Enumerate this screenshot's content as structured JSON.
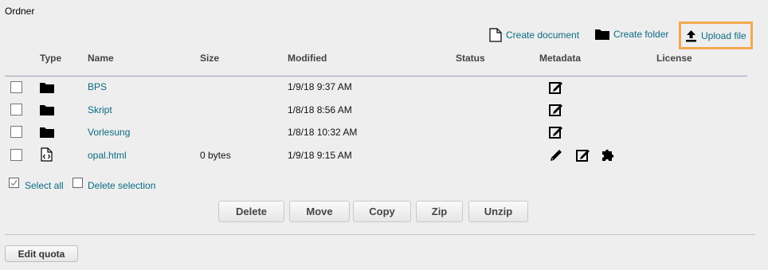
{
  "panel": {
    "title": "Ordner"
  },
  "toolbar": {
    "create_document": "Create document",
    "create_folder": "Create folder",
    "upload_file": "Upload file"
  },
  "columns": [
    "Type",
    "Name",
    "Size",
    "Modified",
    "Status",
    "Metadata",
    "License"
  ],
  "rows": [
    {
      "type": "folder",
      "name": "BPS",
      "size": "",
      "modified": "1/9/18 9:37 AM"
    },
    {
      "type": "folder",
      "name": "Skript",
      "size": "",
      "modified": "1/8/18 8:56 AM"
    },
    {
      "type": "folder",
      "name": "Vorlesung",
      "size": "",
      "modified": "1/8/18 10:32 AM"
    },
    {
      "type": "html-file",
      "name": "opal.html",
      "size": "0 bytes",
      "modified": "1/9/18 9:15 AM"
    }
  ],
  "selection": {
    "select_all": "Select all",
    "delete_selection": "Delete selection"
  },
  "actions": {
    "delete": "Delete",
    "move": "Move",
    "copy": "Copy",
    "zip": "Zip",
    "unzip": "Unzip"
  },
  "footer": {
    "edit_quota": "Edit quota"
  },
  "colors": {
    "link": "#0a6b84",
    "highlight_border": "#f4a851",
    "background": "#eeeeee"
  }
}
